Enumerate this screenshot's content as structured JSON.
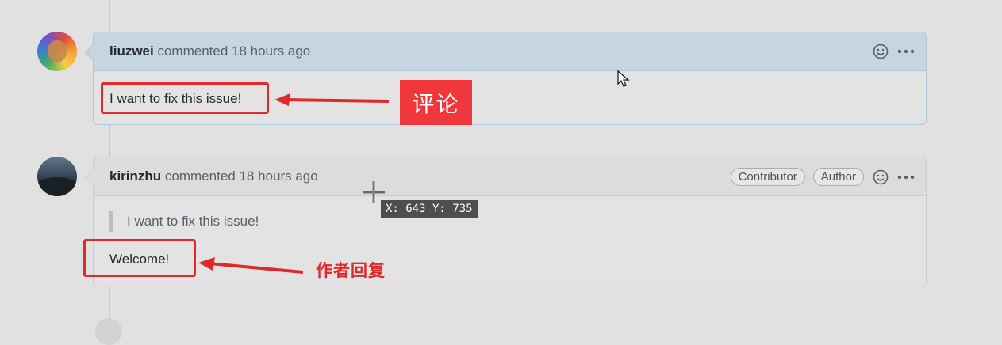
{
  "comments": [
    {
      "author": "liuzwei",
      "action_text": "commented 18 hours ago",
      "body": "I want to fix this issue!"
    },
    {
      "author": "kirinzhu",
      "action_text": "commented 18 hours ago",
      "badges": [
        "Contributor",
        "Author"
      ],
      "quote": "I want to fix this issue!",
      "body": "Welcome!"
    }
  ],
  "annotations": {
    "comment_label": "评论",
    "author_reply_label": "作者回复"
  },
  "coord_readout": "X: 643 Y: 735",
  "colors": {
    "annotation_red": "#e02a2a",
    "callout_bg": "#f0373c",
    "highlight_header": "#c6d6e1"
  },
  "icons": [
    "smiley-icon",
    "kebab-menu-icon",
    "mouse-pointer-icon",
    "crosshair-icon"
  ]
}
